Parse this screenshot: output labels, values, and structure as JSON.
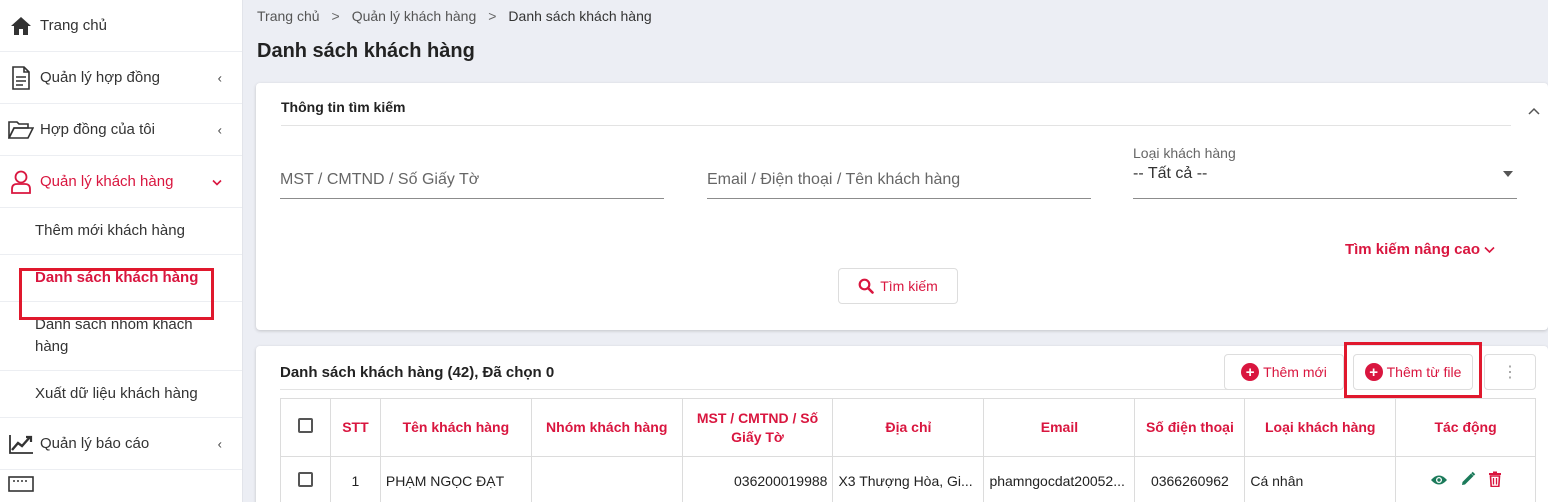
{
  "sidebar": {
    "items": [
      {
        "label": "Trang chủ"
      },
      {
        "label": "Quản lý hợp đồng"
      },
      {
        "label": "Hợp đồng của tôi"
      },
      {
        "label": "Quản lý khách hàng"
      },
      {
        "label": "Quản lý báo cáo"
      }
    ],
    "sub_items": [
      {
        "label": "Thêm mới khách hàng"
      },
      {
        "label": "Danh sách khách hàng"
      },
      {
        "label": "Danh sách nhóm khách hàng"
      },
      {
        "label": "Xuất dữ liệu khách hàng"
      }
    ]
  },
  "breadcrumb": [
    "Trang chủ",
    "Quản lý khách hàng",
    "Danh sách khách hàng"
  ],
  "page_title": "Danh sách khách hàng",
  "search": {
    "title": "Thông tin tìm kiếm",
    "tax_placeholder": "MST / CMTND / Số Giấy Tờ",
    "contact_placeholder": "Email / Điện thoại / Tên khách hàng",
    "type_label": "Loại khách hàng",
    "type_value": "-- Tất cả --",
    "advanced_label": "Tìm kiếm nâng cao",
    "search_button": "Tìm kiếm"
  },
  "list": {
    "title": "Danh sách khách hàng (42), Đã chọn 0",
    "add_new": "Thêm mới",
    "add_from_file": "Thêm từ file",
    "more": "⋮",
    "columns": [
      "STT",
      "Tên khách hàng",
      "Nhóm khách hàng",
      "MST / CMTND / Số Giấy Tờ",
      "Địa chỉ",
      "Email",
      "Số điện thoại",
      "Loại khách hàng",
      "Tác động"
    ],
    "rows": [
      {
        "stt": "1",
        "name": "PHẠM NGỌC ĐẠT",
        "group": "",
        "tax": "036200019988",
        "address": "X3 Thượng Hòa, Gi...",
        "email": "phamngocdat20052...",
        "phone": "0366260962",
        "type": "Cá nhân"
      }
    ]
  },
  "colors": {
    "accent": "#d9163f",
    "highlight_box": "#e0182d"
  }
}
